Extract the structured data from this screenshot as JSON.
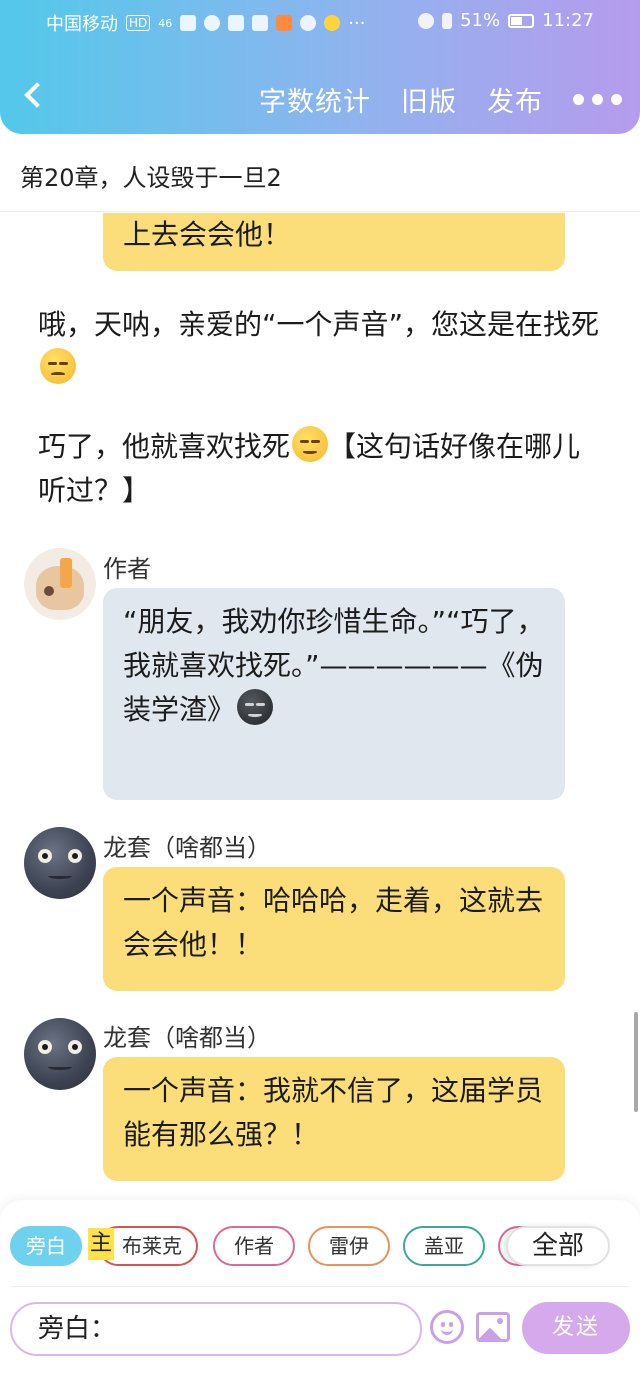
{
  "status_bar": {
    "carrier": "中国移动",
    "hd": "HD",
    "network": "46",
    "ellipsis": "···",
    "battery": "51%",
    "time": "11:27"
  },
  "nav": {
    "word_count": "字数统计",
    "old_version": "旧版",
    "publish": "发布"
  },
  "chapter_title": "第20章，人设毁于一旦2",
  "messages": {
    "partial_bubble": "上去会会他！",
    "narration1": "哦，天呐，亲爱的“一个声音”，您这是在找死",
    "narration2_a": "巧了，他就喜欢找死",
    "narration2_b": "【这句话好像在哪儿听过？】",
    "author_name": "作者",
    "author_bubble": "“朋友，我劝你珍惜生命。”“巧了，我就喜欢找死。”——————《伪装学渣》",
    "speaker2_name": "龙套（啥都当）",
    "speaker2_bubble": "一个声音：哈哈哈，走着，这就去会会他！！",
    "speaker3_name": "龙套（啥都当）",
    "speaker3_bubble": "一个声音：我就不信了，这届学员能有那么强？！"
  },
  "chips": {
    "narrator": "旁白",
    "protagonist_tag": "主",
    "blake": "布莱克",
    "author": "作者",
    "rey": "雷伊",
    "gaia": "盖亚",
    "all": "全部"
  },
  "input": {
    "value": "旁白：",
    "send": "发送"
  },
  "icons": {
    "back": "chevron-left-icon",
    "more": "more-dots-icon",
    "emoji": "smile-icon",
    "image": "image-icon"
  },
  "colors": {
    "header_gradient_start": "#52c8ea",
    "header_gradient_end": "#b69bec",
    "bubble_yellow": "#fbde79",
    "bubble_grey": "#e1e7ee",
    "active_chip": "#6ed2ee",
    "send_button": "#d6a8ec"
  }
}
